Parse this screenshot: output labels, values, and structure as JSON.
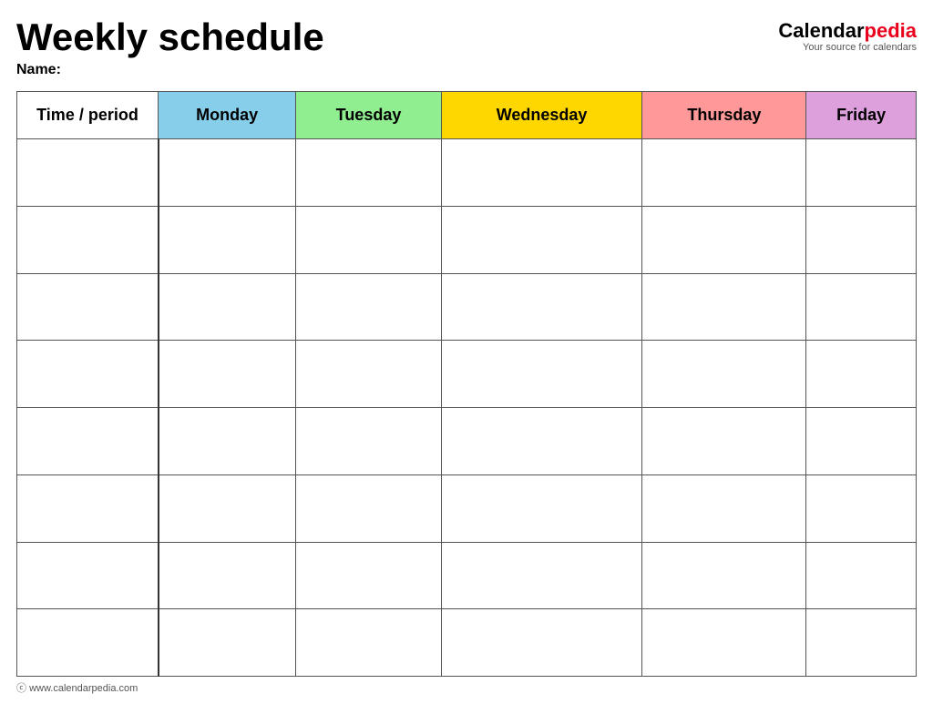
{
  "header": {
    "title": "Weekly schedule",
    "name_label": "Name:",
    "logo": {
      "text_calendar": "Calendar",
      "text_pedia": "pedia",
      "tagline": "Your source for calendars"
    }
  },
  "table": {
    "columns": [
      {
        "id": "time",
        "label": "Time / period",
        "color": "#ffffff"
      },
      {
        "id": "monday",
        "label": "Monday",
        "color": "#87CEEB"
      },
      {
        "id": "tuesday",
        "label": "Tuesday",
        "color": "#90EE90"
      },
      {
        "id": "wednesday",
        "label": "Wednesday",
        "color": "#FFD700"
      },
      {
        "id": "thursday",
        "label": "Thursday",
        "color": "#FF9999"
      },
      {
        "id": "friday",
        "label": "Friday",
        "color": "#DDA0DD"
      }
    ],
    "row_count": 8
  },
  "footer": {
    "url": "www.calendarpedia.com"
  }
}
